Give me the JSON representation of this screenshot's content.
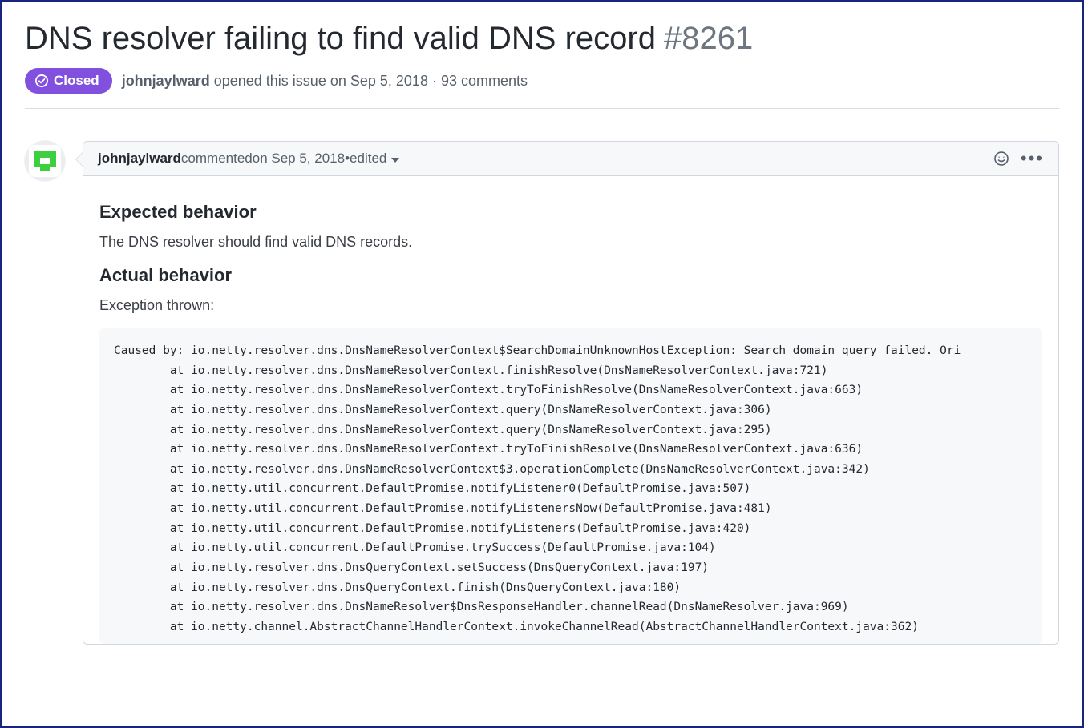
{
  "issue": {
    "title": "DNS resolver failing to find valid DNS record",
    "number": "#8261",
    "state_label": "Closed",
    "author": "johnjaylward",
    "opened_text": " opened this issue ",
    "opened_date": "on Sep 5, 2018",
    "separator": " · ",
    "comment_count_text": "93 comments"
  },
  "comment": {
    "author": "johnjaylward",
    "action_text": " commented ",
    "date_text": "on Sep 5, 2018",
    "bullet": " • ",
    "edited_label": "edited",
    "body": {
      "h_expected": "Expected behavior",
      "p_expected": "The DNS resolver should find valid DNS records.",
      "h_actual": "Actual behavior",
      "p_actual": "Exception thrown:",
      "stacktrace": "Caused by: io.netty.resolver.dns.DnsNameResolverContext$SearchDomainUnknownHostException: Search domain query failed. Ori\n        at io.netty.resolver.dns.DnsNameResolverContext.finishResolve(DnsNameResolverContext.java:721)\n        at io.netty.resolver.dns.DnsNameResolverContext.tryToFinishResolve(DnsNameResolverContext.java:663)\n        at io.netty.resolver.dns.DnsNameResolverContext.query(DnsNameResolverContext.java:306)\n        at io.netty.resolver.dns.DnsNameResolverContext.query(DnsNameResolverContext.java:295)\n        at io.netty.resolver.dns.DnsNameResolverContext.tryToFinishResolve(DnsNameResolverContext.java:636)\n        at io.netty.resolver.dns.DnsNameResolverContext$3.operationComplete(DnsNameResolverContext.java:342)\n        at io.netty.util.concurrent.DefaultPromise.notifyListener0(DefaultPromise.java:507)\n        at io.netty.util.concurrent.DefaultPromise.notifyListenersNow(DefaultPromise.java:481)\n        at io.netty.util.concurrent.DefaultPromise.notifyListeners(DefaultPromise.java:420)\n        at io.netty.util.concurrent.DefaultPromise.trySuccess(DefaultPromise.java:104)\n        at io.netty.resolver.dns.DnsQueryContext.setSuccess(DnsQueryContext.java:197)\n        at io.netty.resolver.dns.DnsQueryContext.finish(DnsQueryContext.java:180)\n        at io.netty.resolver.dns.DnsNameResolver$DnsResponseHandler.channelRead(DnsNameResolver.java:969)\n        at io.netty.channel.AbstractChannelHandlerContext.invokeChannelRead(AbstractChannelHandlerContext.java:362)"
    }
  },
  "icons": {
    "closed": "check-circle-icon",
    "emoji": "emoji-icon",
    "kebab": "kebab-icon",
    "caret": "caret-down-icon"
  }
}
